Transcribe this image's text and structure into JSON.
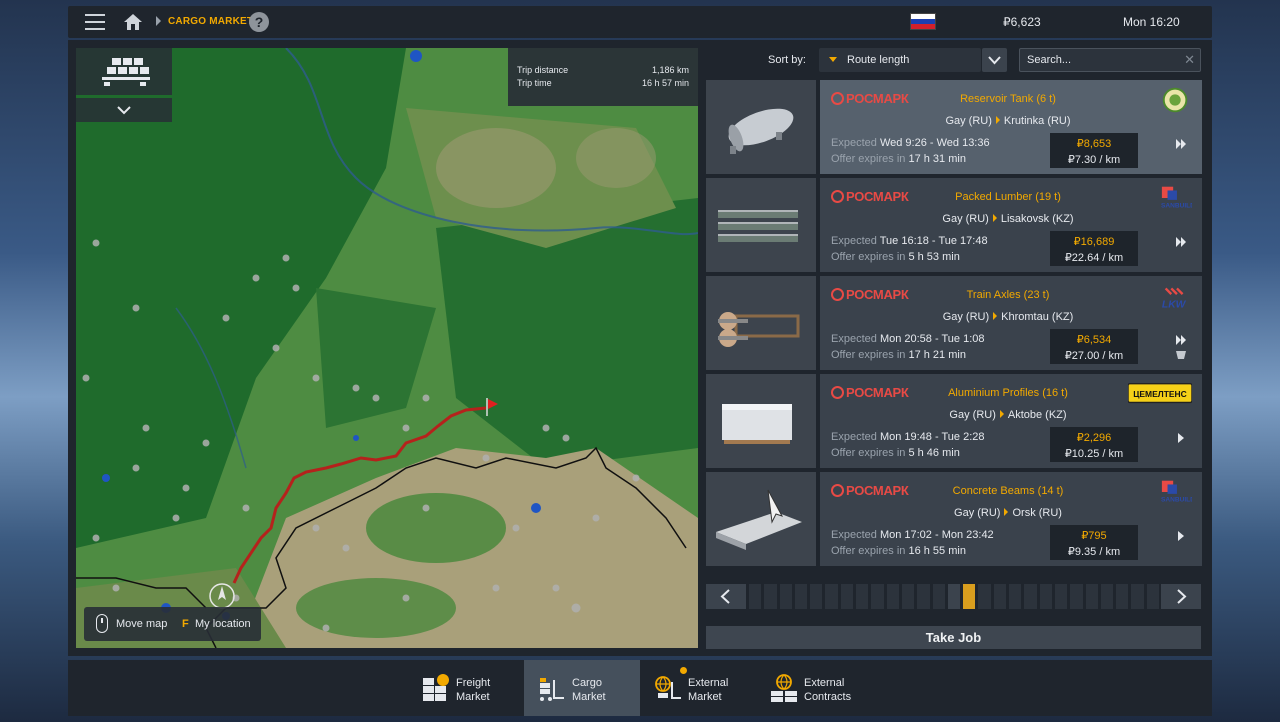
{
  "topbar": {
    "breadcrumb": "CARGO MARKET",
    "help": "?",
    "money": "₽6,623",
    "time": "Mon 16:20"
  },
  "map": {
    "trip_distance_label": "Trip distance",
    "trip_distance_value": "1,186 km",
    "trip_time_label": "Trip time",
    "trip_time_value": "16 h 57 min",
    "hint_move": "Move map",
    "hint_key": "F",
    "hint_location": "My location"
  },
  "sort": {
    "label": "Sort by:",
    "value": "Route length",
    "search_placeholder": "Search..."
  },
  "jobs": [
    {
      "brand": "РОСМАРК",
      "title": "Reservoir Tank (6 t)",
      "from": "Gay (RU)",
      "to": "Krutinka (RU)",
      "expected_label": "Expected",
      "expected": "Wed 9:26 - Wed 13:36",
      "offer_label": "Offer expires in",
      "offer": "17 h 31 min",
      "price": "₽8,653",
      "per_km": "₽7.30 / km",
      "logo": "green-circle-logo"
    },
    {
      "brand": "РОСМАРК",
      "title": "Packed Lumber (19 t)",
      "from": "Gay (RU)",
      "to": "Lisakovsk (KZ)",
      "expected_label": "Expected",
      "expected": "Tue 16:18 - Tue 17:48",
      "offer_label": "Offer expires in",
      "offer": "5 h 53 min",
      "price": "₽16,689",
      "per_km": "₽22.64 / km",
      "logo": "SANBUILDERS"
    },
    {
      "brand": "РОСМАРК",
      "title": "Train Axles (23 t)",
      "from": "Gay (RU)",
      "to": "Khromtau (KZ)",
      "expected_label": "Expected",
      "expected": "Mon 20:58 - Tue 1:08",
      "offer_label": "Offer expires in",
      "offer": "17 h 21 min",
      "price": "₽6,534",
      "per_km": "₽27.00 / km",
      "logo": "LKW"
    },
    {
      "brand": "РОСМАРК",
      "title": "Aluminium Profiles (16 t)",
      "from": "Gay (RU)",
      "to": "Aktobe (KZ)",
      "expected_label": "Expected",
      "expected": "Mon 19:48 - Tue 2:28",
      "offer_label": "Offer expires in",
      "offer": "5 h 46 min",
      "price": "₽2,296",
      "per_km": "₽10.25 / km",
      "logo": "ЦЕМЕЛТЕНС"
    },
    {
      "brand": "РОСМАРК",
      "title": "Concrete Beams (14 t)",
      "from": "Gay (RU)",
      "to": "Orsk (RU)",
      "expected_label": "Expected",
      "expected": "Mon 17:02 - Mon 23:42",
      "offer_label": "Offer expires in",
      "offer": "16 h 55 min",
      "price": "₽795",
      "per_km": "₽9.35 / km",
      "logo": "SANBUILDERS"
    }
  ],
  "pagination": {
    "pages": 27,
    "active_page": 14
  },
  "take_job": "Take Job",
  "tabs": [
    {
      "line1": "Freight",
      "line2": "Market",
      "icon": "freight-market-icon"
    },
    {
      "line1": "Cargo",
      "line2": "Market",
      "icon": "cargo-market-icon"
    },
    {
      "line1": "External",
      "line2": "Market",
      "icon": "external-market-icon"
    },
    {
      "line1": "External",
      "line2": "Contracts",
      "icon": "external-contracts-icon"
    }
  ],
  "colors": {
    "accent": "#f2a900",
    "brand_red": "#e84a45",
    "route": "#b5221c"
  }
}
